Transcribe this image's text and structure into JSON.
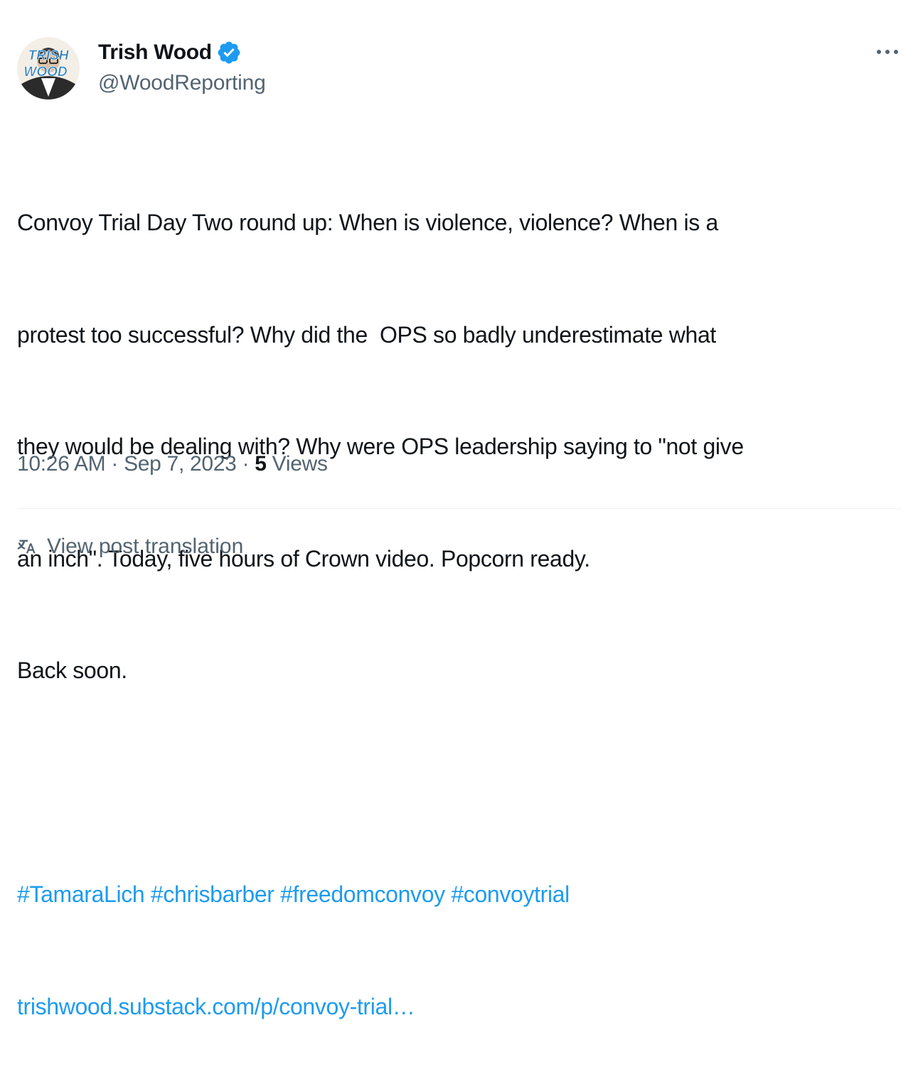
{
  "author": {
    "display_name": "Trish Wood",
    "handle": "@WoodReporting",
    "avatar_text": "TRISH WOOD",
    "verified": true
  },
  "tweet": {
    "lines": [
      "Convoy Trial Day Two round up: When is violence, violence? When is a",
      "protest too successful? Why did the  OPS so badly underestimate what",
      "they would be dealing with? Why were OPS leadership saying to \"not give",
      "an inch\". Today, five hours of Crown video. Popcorn ready.",
      "Back soon."
    ],
    "hashtags": [
      "#TamaraLich",
      "#chrisbarber",
      "#freedomconvoy",
      "#convoytrial"
    ],
    "link": "trishwood.substack.com/p/convoy-trial…"
  },
  "meta": {
    "time": "10:26 AM",
    "separator": "·",
    "date": "Sep 7, 2023",
    "views_count": "5",
    "views_label": "Views"
  },
  "translate_label": "View post translation",
  "colors": {
    "accent": "#1d9bf0",
    "text": "#0f1419",
    "secondary": "#536471",
    "divider": "#eff3f4"
  },
  "icons": {
    "verified": "verified-badge-icon",
    "more": "more-options-icon",
    "translate": "translate-icon"
  }
}
